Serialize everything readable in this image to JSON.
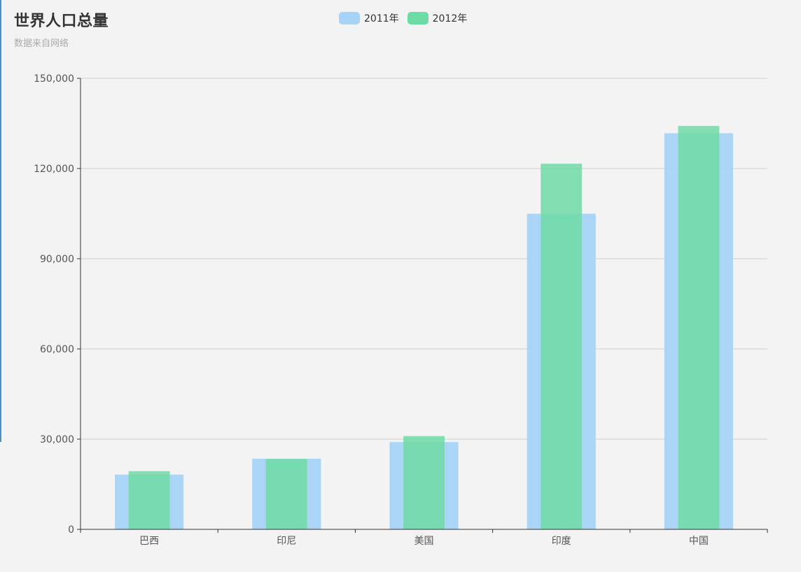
{
  "chart_data": {
    "type": "bar",
    "title": "世界人口总量",
    "subtitle": "数据来自网络",
    "categories": [
      "巴西",
      "印尼",
      "美国",
      "印度",
      "中国"
    ],
    "series": [
      {
        "name": "2011年",
        "values": [
          18203,
          23489,
          29034,
          104970,
          131744
        ],
        "color": "#a7d3f7"
      },
      {
        "name": "2012年",
        "values": [
          19325,
          23438,
          31000,
          121594,
          134141
        ],
        "color": "#6fdba4"
      }
    ],
    "ylim": [
      0,
      150000
    ],
    "yticks": [
      0,
      30000,
      60000,
      90000,
      120000,
      150000
    ],
    "ytick_labels": [
      "0",
      "30,000",
      "60,000",
      "90,000",
      "120,000",
      "150,000"
    ],
    "grid": true,
    "legend_position": "top-center"
  }
}
